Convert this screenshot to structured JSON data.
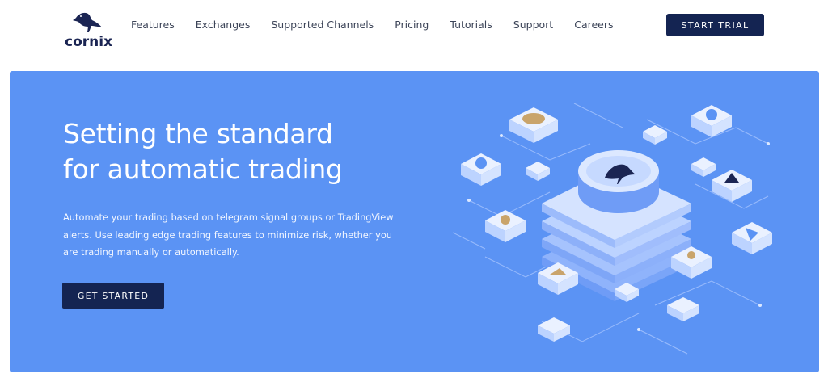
{
  "header": {
    "logo_text": "cornix",
    "logo_icon": "raven-icon",
    "nav": [
      {
        "label": "Features"
      },
      {
        "label": "Exchanges"
      },
      {
        "label": "Supported Channels"
      },
      {
        "label": "Pricing"
      },
      {
        "label": "Tutorials"
      },
      {
        "label": "Support"
      },
      {
        "label": "Careers"
      }
    ],
    "cta_label": "START TRIAL"
  },
  "hero": {
    "title_line1": "Setting the standard",
    "title_line2": "for automatic trading",
    "description": "Automate your trading based on telegram signal groups or TradingView alerts. Use leading edge trading features to minimize risk, whether you are trading manually or automatically.",
    "cta_label": "GET STARTED",
    "illustration": "isometric-trading-platform-illustration"
  },
  "colors": {
    "brand_navy": "#142452",
    "hero_blue": "#5b93f4",
    "text_white": "#ffffff"
  }
}
